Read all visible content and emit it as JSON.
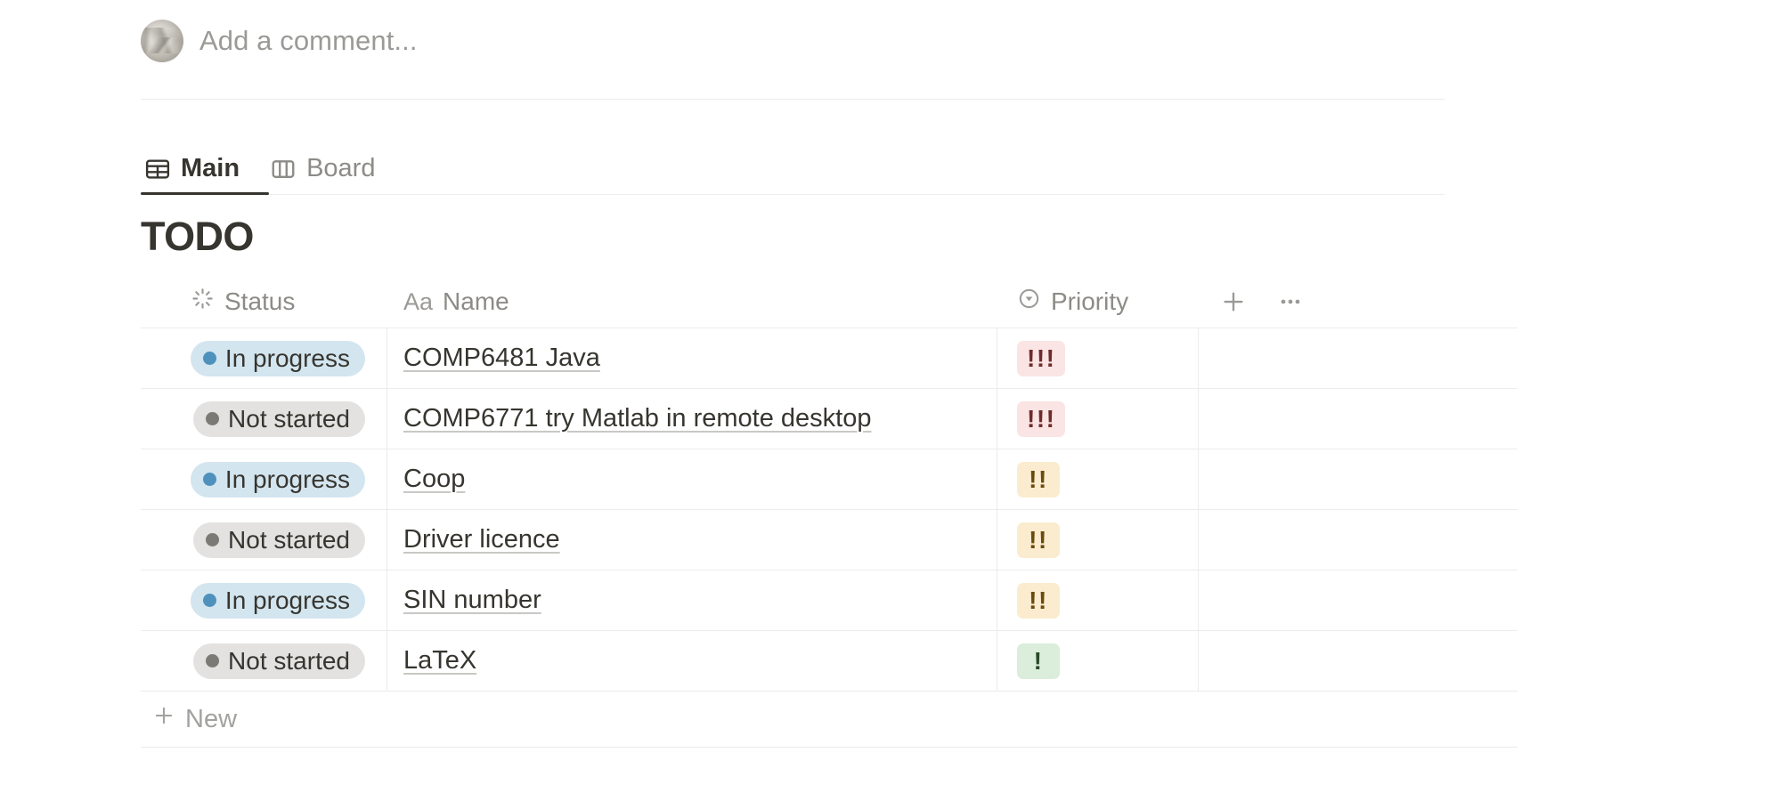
{
  "comment": {
    "placeholder": "Add a comment...",
    "avatar_icon": "user-avatar-photo"
  },
  "tabs": [
    {
      "label": "Main",
      "icon": "table-grid-icon",
      "active": true
    },
    {
      "label": "Board",
      "icon": "board-columns-icon",
      "active": false
    }
  ],
  "database": {
    "title": "TODO",
    "columns": [
      {
        "label": "Status",
        "icon": "status-spinner-icon"
      },
      {
        "label": "Name",
        "icon": "text-aa-icon"
      },
      {
        "label": "Priority",
        "icon": "select-circle-chevron-icon"
      }
    ],
    "tools": [
      {
        "name": "add-column-button",
        "icon": "plus-icon"
      },
      {
        "name": "more-options-button",
        "icon": "ellipsis-icon"
      }
    ],
    "rows": [
      {
        "status": "In progress",
        "status_kind": "in-progress",
        "name": "COMP6481 Java",
        "priority": "!!!",
        "priority_level": "high"
      },
      {
        "status": "Not started",
        "status_kind": "not-started",
        "name": "COMP6771 try Matlab in remote desktop",
        "priority": "!!!",
        "priority_level": "high"
      },
      {
        "status": "In progress",
        "status_kind": "in-progress",
        "name": "Coop",
        "priority": "!!",
        "priority_level": "medium"
      },
      {
        "status": "Not started",
        "status_kind": "not-started",
        "name": "Driver licence",
        "priority": "!!",
        "priority_level": "medium"
      },
      {
        "status": "In progress",
        "status_kind": "in-progress",
        "name": "SIN number",
        "priority": "!!",
        "priority_level": "medium"
      },
      {
        "status": "Not started",
        "status_kind": "not-started",
        "name": "LaTeX",
        "priority": "!",
        "priority_level": "low"
      }
    ],
    "new_row_label": "New"
  },
  "colors": {
    "status_in_progress_bg": "#d3e5ef",
    "status_in_progress_dot": "#4f91bd",
    "status_not_started_bg": "#e3e2e0",
    "status_not_started_dot": "#7c7a75",
    "priority_high_bg": "#fbe4e4",
    "priority_medium_bg": "#fbeccf",
    "priority_low_bg": "#dbeddb",
    "text_primary": "#37352f",
    "text_muted": "#9b9a97",
    "border": "#ececeb"
  }
}
